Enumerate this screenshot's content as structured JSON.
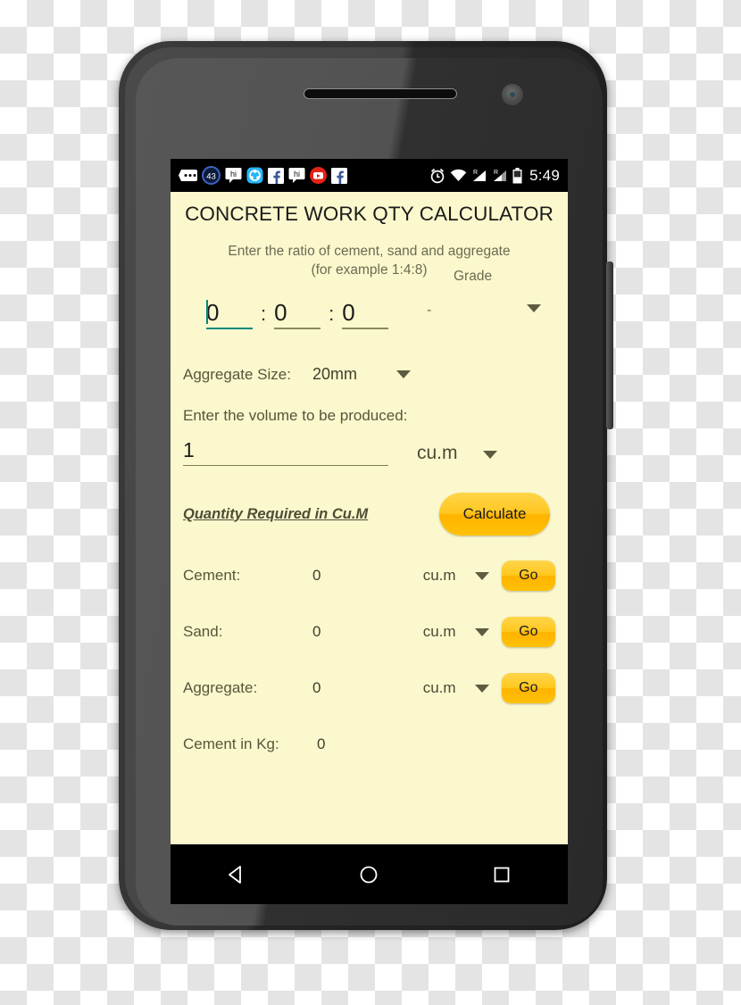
{
  "status_bar": {
    "notification_icons": [
      "messages-icon",
      "badge-43-icon",
      "hike-icon",
      "shareit-icon",
      "facebook-icon",
      "hike-2-icon",
      "youtube-icon",
      "facebook-2-icon"
    ],
    "badge_count": "43",
    "system_icons": [
      "alarm-icon",
      "wifi-icon",
      "signal-1-roaming-icon",
      "signal-2-roaming-icon",
      "battery-icon"
    ],
    "roaming_label": "R",
    "clock": "5:49"
  },
  "app": {
    "title": "CONCRETE WORK QTY CALCULATOR",
    "ratio_hint_line1": "Enter the ratio of cement, sand and aggregate",
    "ratio_hint_line2": "(for example 1:4:8)",
    "ratio": {
      "cement": "0",
      "sand": "0",
      "aggregate": "0",
      "separator": ":"
    },
    "grade": {
      "label": "Grade",
      "value": "-"
    },
    "aggregate_size": {
      "label": "Aggregate Size:",
      "value": "20mm"
    },
    "volume": {
      "label": "Enter the volume to be produced:",
      "value": "1",
      "unit": "cu.m"
    },
    "results_heading": "Quantity Required in Cu.M",
    "calculate_label": "Calculate",
    "results": [
      {
        "label": "Cement:",
        "value": "0",
        "unit": "cu.m",
        "action": "Go",
        "has_action": true
      },
      {
        "label": "Sand:",
        "value": "0",
        "unit": "cu.m",
        "action": "Go",
        "has_action": true
      },
      {
        "label": "Aggregate:",
        "value": "0",
        "unit": "cu.m",
        "action": "Go",
        "has_action": true
      },
      {
        "label": "Cement in Kg:",
        "value": "0",
        "unit": "",
        "action": "",
        "has_action": false
      }
    ]
  },
  "nav_bar": {
    "back": "back-icon",
    "home": "home-icon",
    "recents": "recents-icon"
  },
  "colors": {
    "screen_background": "#fbf8cd",
    "accent_button": "#ffc107",
    "focus_underline": "#00897b",
    "text_primary": "#1b1b1b",
    "text_secondary": "#6b6b53"
  }
}
